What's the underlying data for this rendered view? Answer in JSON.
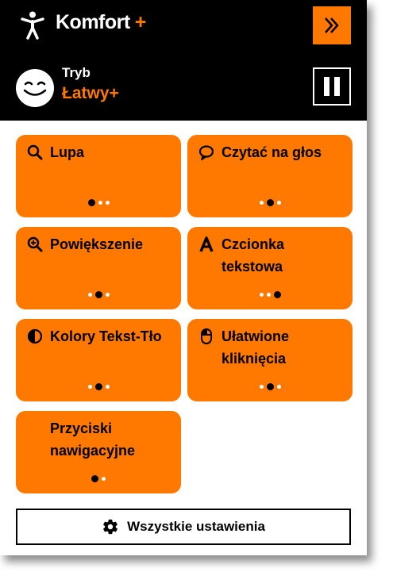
{
  "header": {
    "title": "Komfort",
    "title_plus": "+",
    "collapse_icon": "double-chevron-right-icon",
    "mode_label": "Tryb",
    "mode_value": "Łatwy+"
  },
  "colors": {
    "accent": "#ff7900",
    "header_bg": "#000000",
    "text": "#000000"
  },
  "tiles": [
    {
      "label": "Lupa",
      "icon": "magnifier-icon",
      "dots_total": 3,
      "dots_active": 1
    },
    {
      "label": "Czytać na głos",
      "icon": "speech-bubble-icon",
      "dots_total": 3,
      "dots_active": 2
    },
    {
      "label": "Powiększenie",
      "icon": "zoom-in-icon",
      "dots_total": 3,
      "dots_active": 2
    },
    {
      "label": "Czcionka tekstowa",
      "icon": "font-a-icon",
      "dots_total": 3,
      "dots_active": 3
    },
    {
      "label": "Kolory Tekst-Tło",
      "icon": "contrast-icon",
      "dots_total": 3,
      "dots_active": 2
    },
    {
      "label": "Ułatwione kliknięcia",
      "icon": "mouse-icon",
      "dots_total": 3,
      "dots_active": 2
    },
    {
      "label": "Przyciski nawigacyjne",
      "icon": "",
      "dots_total": 2,
      "dots_active": 1
    }
  ],
  "settings_button": {
    "label": "Wszystkie ustawienia",
    "icon": "gear-icon"
  }
}
